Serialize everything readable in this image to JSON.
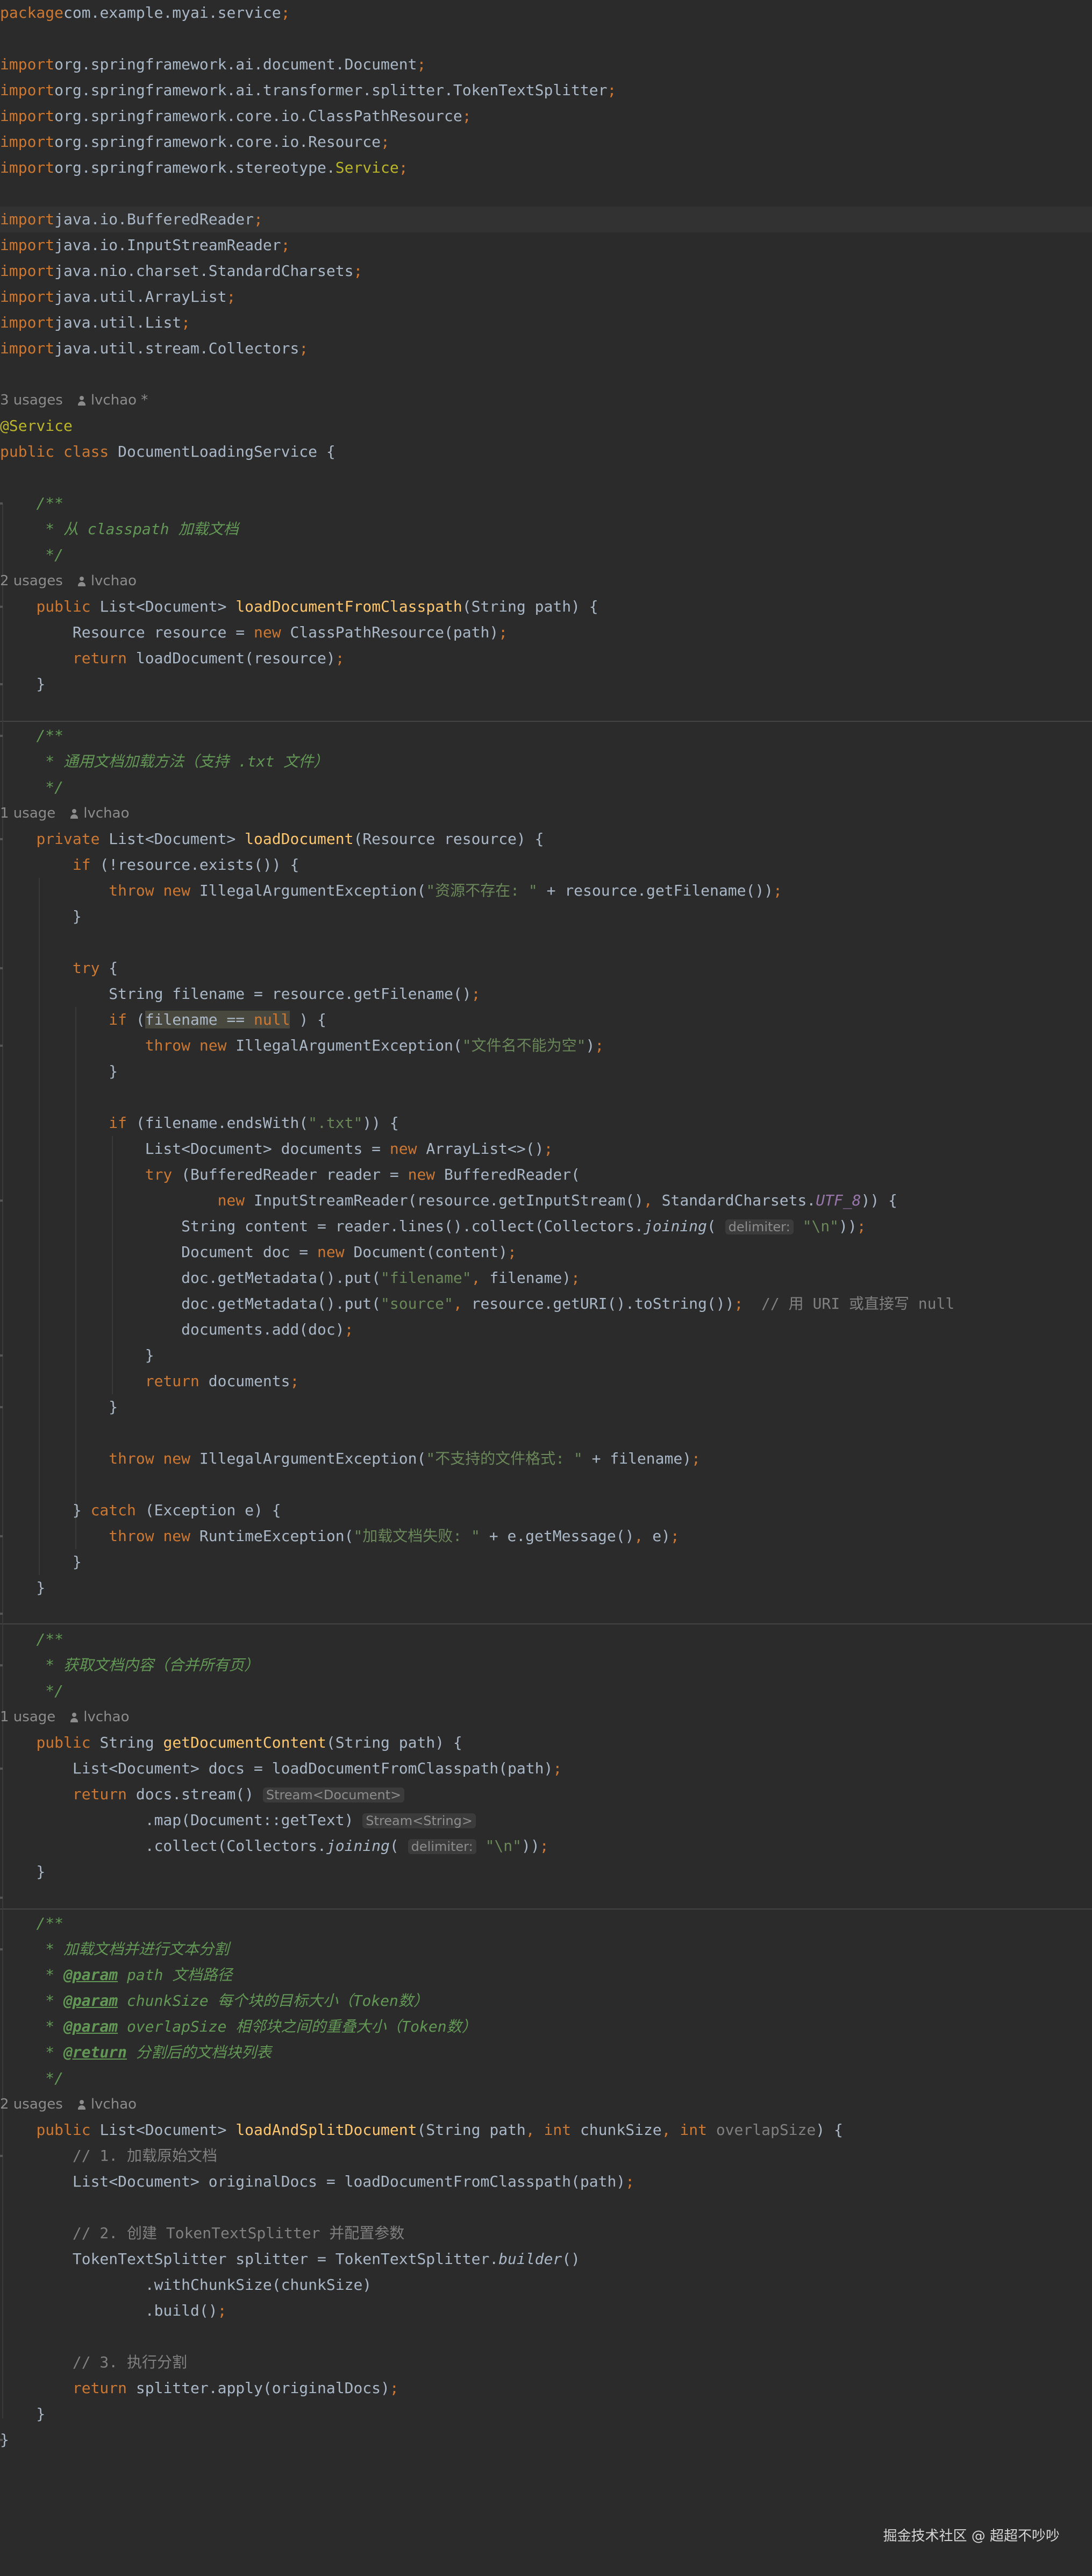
{
  "editor": {
    "lines": [
      [
        [
          "t-kw",
          "package"
        ],
        [
          "",
          "com.example.myai.service"
        ],
        [
          "t-kw",
          ";"
        ]
      ],
      [],
      [
        [
          "t-kw",
          "import"
        ],
        [
          "",
          "org.springframework.ai.document.Document"
        ],
        [
          "t-kw",
          ";"
        ]
      ],
      [
        [
          "t-kw",
          "import"
        ],
        [
          "",
          "org.springframework.ai.transformer.splitter.TokenTextSplitter"
        ],
        [
          "t-kw",
          ";"
        ]
      ],
      [
        [
          "t-kw",
          "import"
        ],
        [
          "",
          "org.springframework.core.io.ClassPathResource"
        ],
        [
          "t-kw",
          ";"
        ]
      ],
      [
        [
          "t-kw",
          "import"
        ],
        [
          "",
          "org.springframework.core.io.Resource"
        ],
        [
          "t-kw",
          ";"
        ]
      ],
      [
        [
          "t-kw",
          "import"
        ],
        [
          "",
          "org.springframework.stereotype."
        ],
        [
          "t-ann",
          "Service"
        ],
        [
          "t-kw",
          ";"
        ]
      ],
      [],
      [
        [
          "t-kw",
          "import"
        ],
        [
          "",
          "java.io.BufferedReader"
        ],
        [
          "t-kw",
          ";"
        ]
      ],
      [
        [
          "t-kw",
          "import"
        ],
        [
          "",
          "java.io.InputStreamReader"
        ],
        [
          "t-kw",
          ";"
        ]
      ],
      [
        [
          "t-kw",
          "import"
        ],
        [
          "",
          "java.nio.charset.StandardCharsets"
        ],
        [
          "t-kw",
          ";"
        ]
      ],
      [
        [
          "t-kw",
          "import"
        ],
        [
          "",
          "java.util.ArrayList"
        ],
        [
          "t-kw",
          ";"
        ]
      ],
      [
        [
          "t-kw",
          "import"
        ],
        [
          "",
          "java.util.List"
        ],
        [
          "t-kw",
          ";"
        ]
      ],
      [
        [
          "t-kw",
          "import"
        ],
        [
          "",
          "java.util.stream.Collectors"
        ],
        [
          "t-kw",
          ";"
        ]
      ],
      [],
      {
        "meta": true,
        "usages": "3 usages",
        "author": "lvchao *"
      },
      [
        [
          "t-ann",
          "@Service"
        ]
      ],
      [
        [
          "t-kw",
          "public class "
        ],
        [
          "",
          "DocumentLoadingService {"
        ]
      ],
      [],
      [
        [
          "",
          "    "
        ],
        [
          "t-doc",
          "/**"
        ]
      ],
      [
        [
          "",
          "    "
        ],
        [
          "t-doc",
          " * 从 classpath 加载文档"
        ]
      ],
      [
        [
          "",
          "    "
        ],
        [
          "t-doc",
          " */"
        ]
      ],
      {
        "meta": true,
        "usages": "2 usages",
        "author": "lvchao"
      },
      [
        [
          "",
          "    "
        ],
        [
          "t-kw",
          "public "
        ],
        [
          "",
          "List<Document> "
        ],
        [
          "t-fn",
          "loadDocumentFromClasspath"
        ],
        [
          "",
          "(String path) {"
        ]
      ],
      [
        [
          "",
          "        Resource resource = "
        ],
        [
          "t-kw",
          "new "
        ],
        [
          "",
          "ClassPathResource(path)"
        ],
        [
          "t-kw",
          ";"
        ]
      ],
      [
        [
          "",
          "        "
        ],
        [
          "t-kw",
          "return "
        ],
        [
          "",
          "loadDocument(resource)"
        ],
        [
          "t-kw",
          ";"
        ]
      ],
      [
        [
          "",
          "    }"
        ]
      ],
      [],
      [
        [
          "",
          "    "
        ],
        [
          "t-doc",
          "/**"
        ]
      ],
      [
        [
          "",
          "    "
        ],
        [
          "t-doc",
          " * 通用文档加载方法（支持 .txt 文件）"
        ]
      ],
      [
        [
          "",
          "    "
        ],
        [
          "t-doc",
          " */"
        ]
      ],
      {
        "meta": true,
        "usages": "1 usage",
        "author": "lvchao"
      },
      [
        [
          "",
          "    "
        ],
        [
          "t-kw",
          "private "
        ],
        [
          "",
          "List<Document> "
        ],
        [
          "t-fn",
          "loadDocument"
        ],
        [
          "",
          "(Resource resource) {"
        ]
      ],
      [
        [
          "",
          "        "
        ],
        [
          "t-kw",
          "if "
        ],
        [
          "",
          "(!resource.exists()) {"
        ]
      ],
      [
        [
          "",
          "            "
        ],
        [
          "t-kw",
          "throw new "
        ],
        [
          "",
          "IllegalArgumentException("
        ],
        [
          "t-str",
          "\"资源不存在: \""
        ],
        [
          "",
          " + resource.getFilename())"
        ],
        [
          "t-kw",
          ";"
        ]
      ],
      [
        [
          "",
          "        }"
        ]
      ],
      [],
      [
        [
          "",
          "        "
        ],
        [
          "t-kw",
          "try "
        ],
        [
          "",
          "{"
        ]
      ],
      [
        [
          "",
          "            String filename = resource.getFilename()"
        ],
        [
          "t-kw",
          ";"
        ]
      ],
      [
        [
          "",
          "            "
        ],
        [
          "t-kw",
          "if "
        ],
        [
          "",
          "("
        ],
        [
          "t-sel",
          "filename == "
        ],
        [
          "t-sel t-kw",
          "null"
        ],
        [
          "",
          " ) {"
        ]
      ],
      [
        [
          "",
          "                "
        ],
        [
          "t-kw",
          "throw new "
        ],
        [
          "",
          "IllegalArgumentException("
        ],
        [
          "t-str",
          "\"文件名不能为空\""
        ],
        [
          "",
          ")"
        ],
        [
          "t-kw",
          ";"
        ]
      ],
      [
        [
          "",
          "            }"
        ]
      ],
      [],
      [
        [
          "",
          "            "
        ],
        [
          "t-kw",
          "if "
        ],
        [
          "",
          "(filename.endsWith("
        ],
        [
          "t-str",
          "\".txt\""
        ],
        [
          "",
          ")) {"
        ]
      ],
      [
        [
          "",
          "                List<Document> documents = "
        ],
        [
          "t-kw",
          "new "
        ],
        [
          "",
          "ArrayList<>()"
        ],
        [
          "t-kw",
          ";"
        ]
      ],
      [
        [
          "",
          "                "
        ],
        [
          "t-kw",
          "try "
        ],
        [
          "",
          "(BufferedReader reader = "
        ],
        [
          "t-kw",
          "new "
        ],
        [
          "",
          "BufferedReader("
        ]
      ],
      [
        [
          "",
          "                        "
        ],
        [
          "t-kw",
          "new "
        ],
        [
          "",
          "InputStreamReader(resource.getInputStream()"
        ],
        [
          "t-kw",
          ", "
        ],
        [
          "",
          "StandardCharsets."
        ],
        [
          "t-static",
          "UTF_8"
        ],
        [
          "",
          ")) {"
        ]
      ],
      [
        [
          "",
          "                    String content = reader.lines().collect(Collectors."
        ],
        [
          "t-ital",
          "joining"
        ],
        [
          "",
          "( "
        ],
        [
          "t-hint",
          "delimiter:"
        ],
        [
          "",
          " "
        ],
        [
          "t-str",
          "\"\\n\""
        ],
        [
          "",
          "))"
        ],
        [
          "t-kw",
          ";"
        ]
      ],
      [
        [
          "",
          "                    Document doc = "
        ],
        [
          "t-kw",
          "new "
        ],
        [
          "",
          "Document(content)"
        ],
        [
          "t-kw",
          ";"
        ]
      ],
      [
        [
          "",
          "                    doc.getMetadata().put("
        ],
        [
          "t-str",
          "\"filename\""
        ],
        [
          "t-kw",
          ", "
        ],
        [
          "",
          "filename)"
        ],
        [
          "t-kw",
          ";"
        ]
      ],
      [
        [
          "",
          "                    doc.getMetadata().put("
        ],
        [
          "t-str",
          "\"source\""
        ],
        [
          "t-kw",
          ", "
        ],
        [
          "",
          "resource.getURI().toString())"
        ],
        [
          "t-kw",
          ";"
        ],
        [
          "",
          "  "
        ],
        [
          "t-cmt",
          "// 用 URI 或直接写 null"
        ]
      ],
      [
        [
          "",
          "                    documents.add(doc)"
        ],
        [
          "t-kw",
          ";"
        ]
      ],
      [
        [
          "",
          "                }"
        ]
      ],
      [
        [
          "",
          "                "
        ],
        [
          "t-kw",
          "return "
        ],
        [
          "",
          "documents"
        ],
        [
          "t-kw",
          ";"
        ]
      ],
      [
        [
          "",
          "            }"
        ]
      ],
      [],
      [
        [
          "",
          "            "
        ],
        [
          "t-kw",
          "throw new "
        ],
        [
          "",
          "IllegalArgumentException("
        ],
        [
          "t-str",
          "\"不支持的文件格式: \""
        ],
        [
          "",
          " + filename)"
        ],
        [
          "t-kw",
          ";"
        ]
      ],
      [],
      [
        [
          "",
          "        } "
        ],
        [
          "t-kw",
          "catch "
        ],
        [
          "",
          "(Exception e) {"
        ]
      ],
      [
        [
          "",
          "            "
        ],
        [
          "t-kw",
          "throw new "
        ],
        [
          "",
          "RuntimeException("
        ],
        [
          "t-str",
          "\"加载文档失败: \""
        ],
        [
          "",
          " + e.getMessage()"
        ],
        [
          "t-kw",
          ", "
        ],
        [
          "",
          "e)"
        ],
        [
          "t-kw",
          ";"
        ]
      ],
      [
        [
          "",
          "        }"
        ]
      ],
      [
        [
          "",
          "    }"
        ]
      ],
      [],
      [
        [
          "",
          "    "
        ],
        [
          "t-doc",
          "/**"
        ]
      ],
      [
        [
          "",
          "    "
        ],
        [
          "t-doc",
          " * 获取文档内容（合并所有页）"
        ]
      ],
      [
        [
          "",
          "    "
        ],
        [
          "t-doc",
          " */"
        ]
      ],
      {
        "meta": true,
        "usages": "1 usage",
        "author": "lvchao"
      },
      [
        [
          "",
          "    "
        ],
        [
          "t-kw",
          "public "
        ],
        [
          "",
          "String "
        ],
        [
          "t-fn",
          "getDocumentContent"
        ],
        [
          "",
          "(String path) {"
        ]
      ],
      [
        [
          "",
          "        List<Document> docs = loadDocumentFromClasspath(path)"
        ],
        [
          "t-kw",
          ";"
        ]
      ],
      [
        [
          "",
          "        "
        ],
        [
          "t-kw",
          "return "
        ],
        [
          "",
          "docs.stream() "
        ],
        [
          "t-hint",
          "Stream<Document>"
        ]
      ],
      [
        [
          "",
          "                .map(Document::getText) "
        ],
        [
          "t-hint",
          "Stream<String>"
        ]
      ],
      [
        [
          "",
          "                .collect(Collectors."
        ],
        [
          "t-ital",
          "joining"
        ],
        [
          "",
          "( "
        ],
        [
          "t-hint",
          "delimiter:"
        ],
        [
          "",
          " "
        ],
        [
          "t-str",
          "\"\\n\""
        ],
        [
          "",
          "))"
        ],
        [
          "t-kw",
          ";"
        ]
      ],
      [
        [
          "",
          "    }"
        ]
      ],
      [],
      [
        [
          "",
          "    "
        ],
        [
          "t-doc",
          "/**"
        ]
      ],
      [
        [
          "",
          "    "
        ],
        [
          "t-doc",
          " * 加载文档并进行文本分割"
        ]
      ],
      [
        [
          "",
          "    "
        ],
        [
          "t-doc",
          " * "
        ],
        [
          "t-tag",
          "@param"
        ],
        [
          "t-doc",
          " path 文档路径"
        ]
      ],
      [
        [
          "",
          "    "
        ],
        [
          "t-doc",
          " * "
        ],
        [
          "t-tag",
          "@param"
        ],
        [
          "t-doc",
          " chunkSize 每个块的目标大小（Token数）"
        ]
      ],
      [
        [
          "",
          "    "
        ],
        [
          "t-doc",
          " * "
        ],
        [
          "t-tag",
          "@param"
        ],
        [
          "t-doc",
          " overlapSize 相邻块之间的重叠大小（Token数）"
        ]
      ],
      [
        [
          "",
          "    "
        ],
        [
          "t-doc",
          " * "
        ],
        [
          "t-tag",
          "@return"
        ],
        [
          "t-doc",
          " 分割后的文档块列表"
        ]
      ],
      [
        [
          "",
          "    "
        ],
        [
          "t-doc",
          " */"
        ]
      ],
      {
        "meta": true,
        "usages": "2 usages",
        "author": "lvchao"
      },
      [
        [
          "",
          "    "
        ],
        [
          "t-kw",
          "public "
        ],
        [
          "",
          "List<Document> "
        ],
        [
          "t-fn",
          "loadAndSplitDocument"
        ],
        [
          "",
          "(String path"
        ],
        [
          "t-kw",
          ", int "
        ],
        [
          "",
          "chunkSize"
        ],
        [
          "t-kw",
          ", int "
        ],
        [
          "t-unused",
          "overlapSize"
        ],
        [
          "",
          ") {"
        ]
      ],
      [
        [
          "",
          "        "
        ],
        [
          "t-cmt",
          "// 1. 加载原始文档"
        ]
      ],
      [
        [
          "",
          "        List<Document> originalDocs = loadDocumentFromClasspath(path)"
        ],
        [
          "t-kw",
          ";"
        ]
      ],
      [],
      [
        [
          "",
          "        "
        ],
        [
          "t-cmt",
          "// 2. 创建 TokenTextSplitter 并配置参数"
        ]
      ],
      [
        [
          "",
          "        TokenTextSplitter splitter = TokenTextSplitter."
        ],
        [
          "t-ital",
          "builder"
        ],
        [
          "",
          "()"
        ]
      ],
      [
        [
          "",
          "                .withChunkSize(chunkSize)"
        ]
      ],
      [
        [
          "",
          "                .build()"
        ],
        [
          "t-kw",
          ";"
        ]
      ],
      [],
      [
        [
          "",
          "        "
        ],
        [
          "t-cmt",
          "// 3. 执行分割"
        ]
      ],
      [
        [
          "",
          "        "
        ],
        [
          "t-kw",
          "return "
        ],
        [
          "",
          "splitter.apply(originalDocs)"
        ],
        [
          "t-kw",
          ";"
        ]
      ],
      [
        [
          "",
          "    }"
        ]
      ],
      [
        [
          "",
          "}"
        ]
      ]
    ]
  },
  "watermark": "掘金技术社区 @ 超超不吵吵"
}
